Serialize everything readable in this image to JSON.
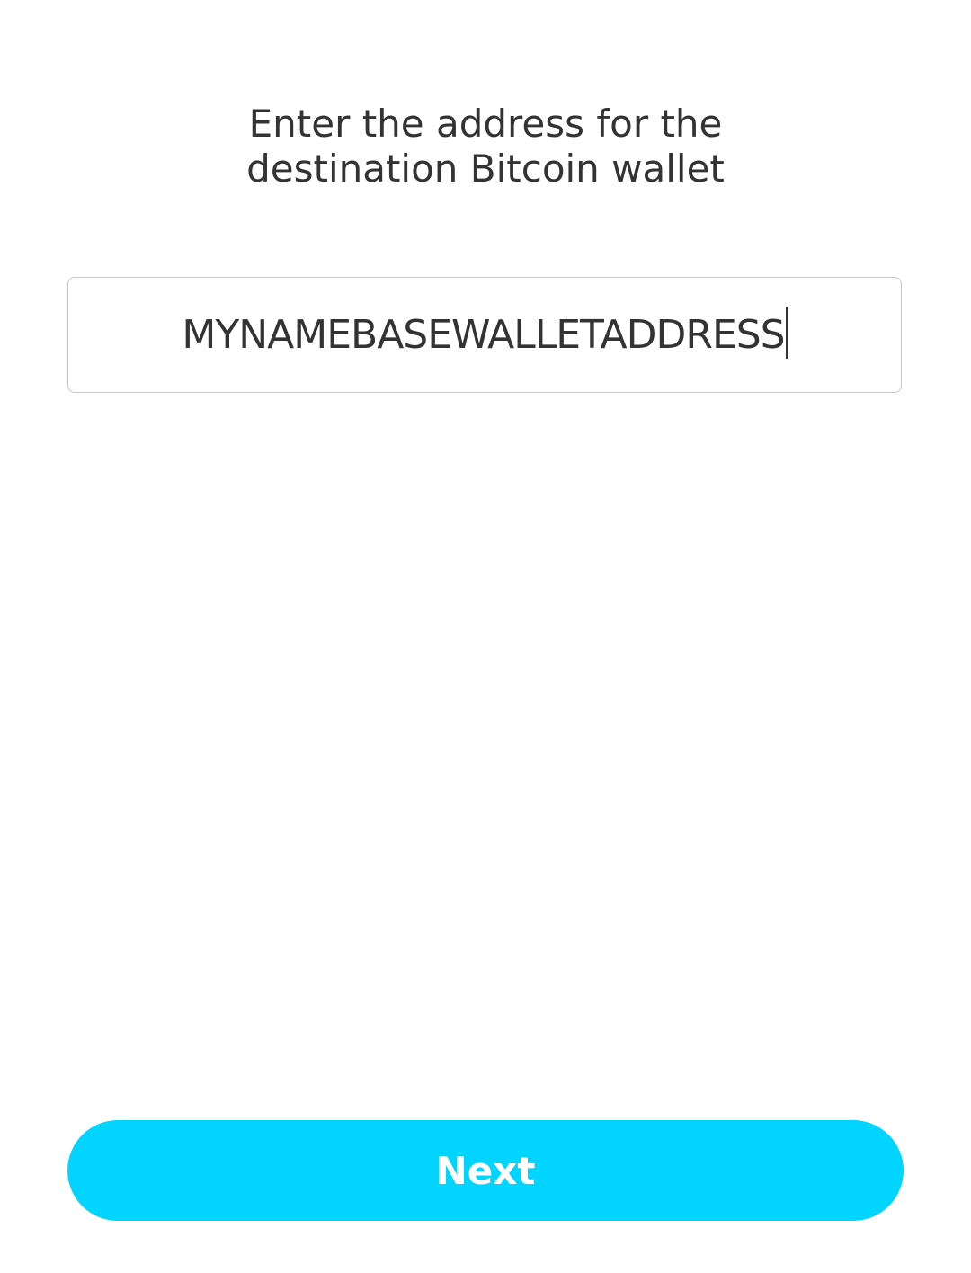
{
  "header": {
    "title_line_1": "Enter the address for the",
    "title_line_2": "destination Bitcoin wallet"
  },
  "address_input": {
    "value": "MYNAMEBASEWALLETADDRESS"
  },
  "footer": {
    "next_label": "Next"
  },
  "colors": {
    "accent": "#00D4FF",
    "text": "#333333",
    "border": "#C8C8C8",
    "button_text": "#FFFFFF"
  }
}
